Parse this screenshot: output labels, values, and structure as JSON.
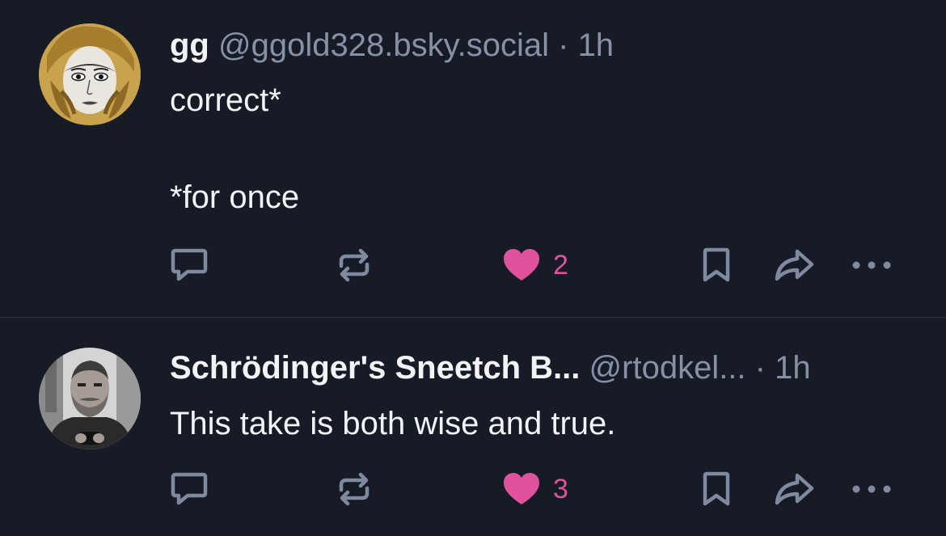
{
  "posts": [
    {
      "author_name": "gg",
      "handle": "@ggold328.bsky.social",
      "separator": "·",
      "time": "1h",
      "text": "correct*\n\n*for once",
      "likes": "2"
    },
    {
      "author_name": "Schrödinger's Sneetch B...",
      "handle": "@rtodkel...",
      "separator": "·",
      "time": "1h",
      "text": "This take is both wise and true.",
      "likes": "3"
    }
  ],
  "colors": {
    "background": "#161b26",
    "text": "#f1f3f5",
    "muted": "#8791a6",
    "icon": "#7f8aa0",
    "like": "#e0529c",
    "divider": "#2c3444"
  },
  "icons": {
    "reply": "speech-bubble-icon",
    "repost": "repost-arrows-icon",
    "like": "heart-icon",
    "bookmark": "bookmark-icon",
    "share": "share-arrow-icon",
    "more": "ellipsis-icon"
  }
}
